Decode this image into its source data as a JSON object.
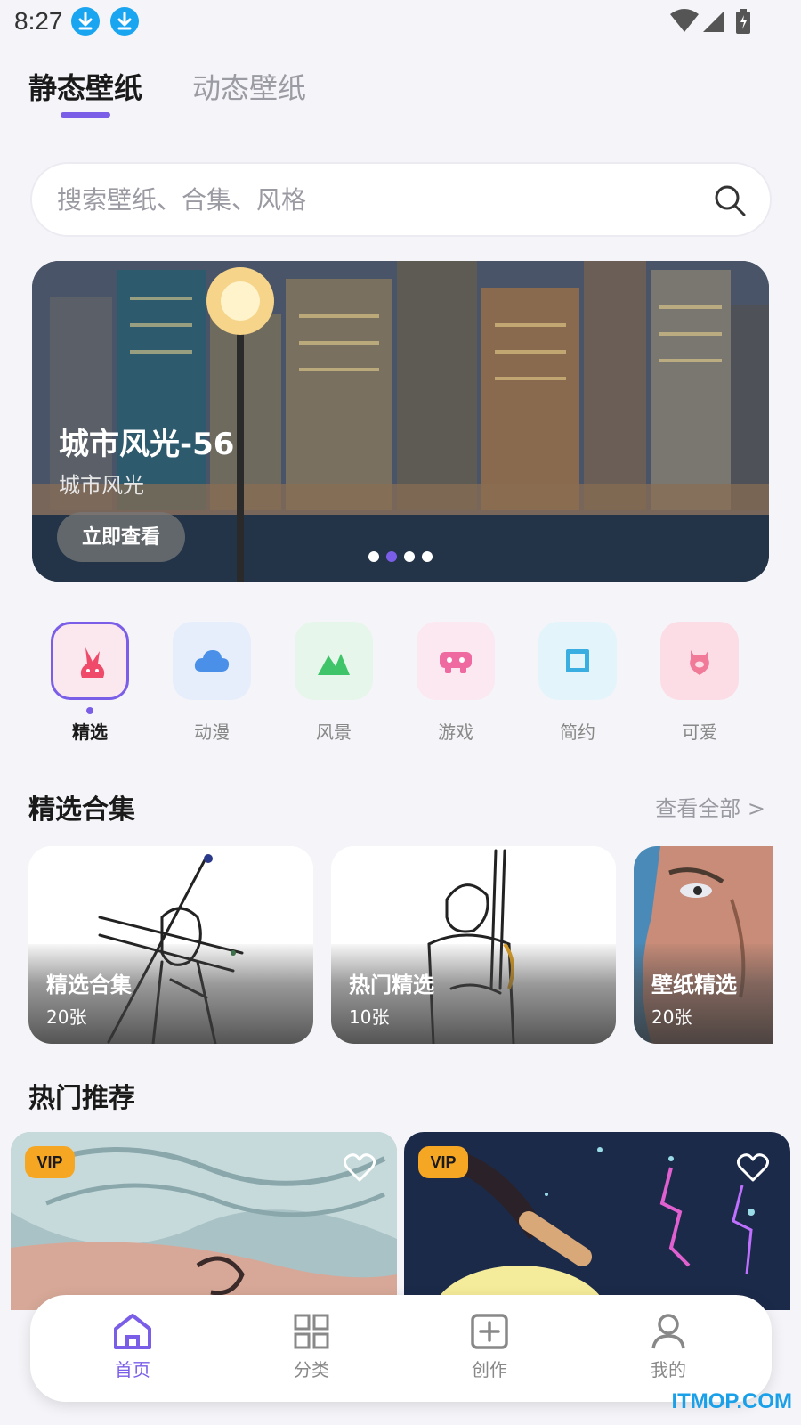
{
  "status_bar": {
    "time": "8:27"
  },
  "tabs": [
    {
      "label": "静态壁纸",
      "active": true
    },
    {
      "label": "动态壁纸",
      "active": false
    }
  ],
  "search": {
    "placeholder": "搜索壁纸、合集、风格"
  },
  "banner": {
    "title": "城市风光-56",
    "subtitle": "城市风光",
    "button_label": "立即查看",
    "page_count": 4,
    "active_page": 2
  },
  "categories": [
    {
      "label": "精选",
      "icon": "rabbit-icon",
      "selected": true,
      "tile_color": "#fbe8ee",
      "icon_color": "#ef4a6a"
    },
    {
      "label": "动漫",
      "icon": "cloud-icon",
      "selected": false,
      "tile_color": "#e6eefc",
      "icon_color": "#4a90e8"
    },
    {
      "label": "风景",
      "icon": "mountain-icon",
      "selected": false,
      "tile_color": "#e6f6ea",
      "icon_color": "#3fc46a"
    },
    {
      "label": "游戏",
      "icon": "gamepad-icon",
      "selected": false,
      "tile_color": "#fbe8f0",
      "icon_color": "#ef6aa0"
    },
    {
      "label": "简约",
      "icon": "square-icon",
      "selected": false,
      "tile_color": "#e3f5fb",
      "icon_color": "#3aaee0"
    },
    {
      "label": "可爱",
      "icon": "pig-icon",
      "selected": false,
      "tile_color": "#fcdde6",
      "icon_color": "#f07a98"
    }
  ],
  "featured": {
    "title": "精选合集",
    "view_all": "查看全部 >",
    "collections": [
      {
        "name": "精选合集",
        "count": "20张"
      },
      {
        "name": "热门精选",
        "count": "10张"
      },
      {
        "name": "壁纸精选",
        "count": "20张"
      }
    ]
  },
  "hot": {
    "title": "热门推荐",
    "cards": [
      {
        "badge": "VIP"
      },
      {
        "badge": "VIP"
      }
    ]
  },
  "nav": [
    {
      "label": "首页",
      "icon": "home-icon",
      "active": true
    },
    {
      "label": "分类",
      "icon": "grid-icon",
      "active": false
    },
    {
      "label": "创作",
      "icon": "plus-square-icon",
      "active": false
    },
    {
      "label": "我的",
      "icon": "user-icon",
      "active": false
    }
  ],
  "colors": {
    "accent": "#7b5ee8",
    "vip": "#f5a623"
  },
  "watermark": "ITMOP.COM"
}
